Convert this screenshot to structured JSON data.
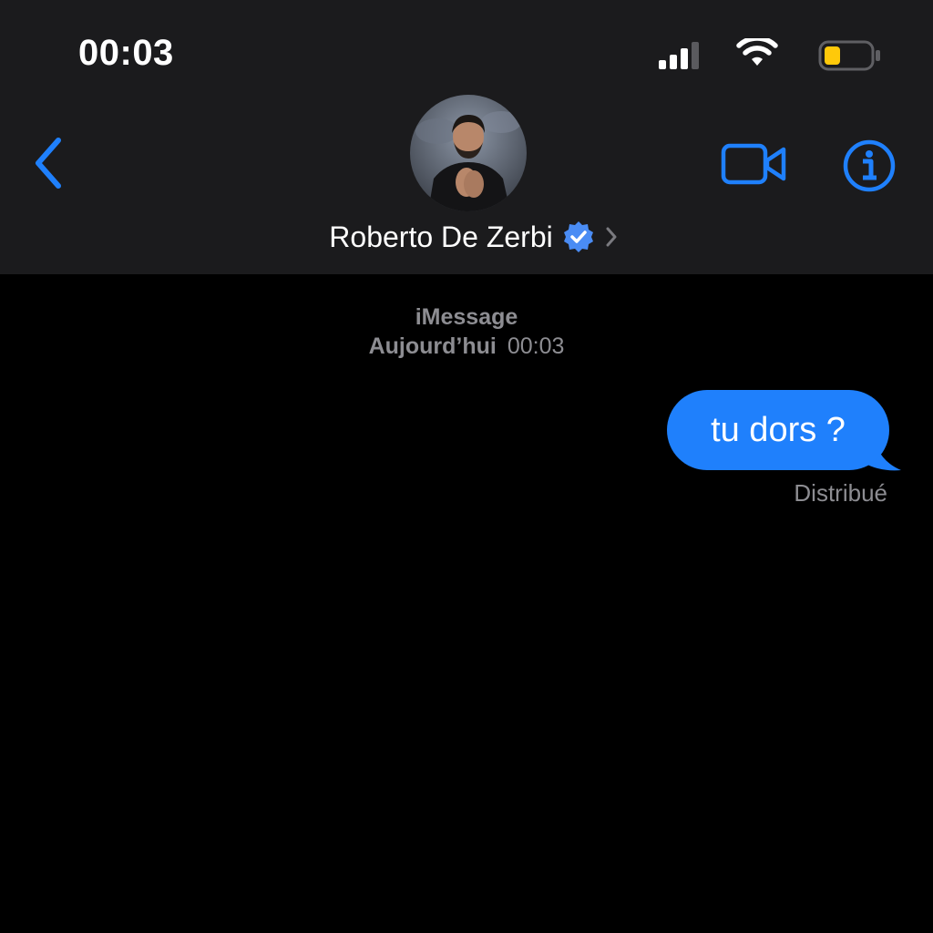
{
  "status_bar": {
    "time": "00:03",
    "icons": [
      "signal-icon",
      "wifi-icon",
      "battery-icon"
    ],
    "battery_level": 0.35,
    "battery_color": "#ffc90a"
  },
  "header": {
    "back_icon": "chevron-left-icon",
    "video_icon": "video-camera-icon",
    "info_icon": "info-icon",
    "contact_name": "Roberto De Zerbi",
    "verified_icon": "verified-badge-icon",
    "disclosure_icon": "chevron-right-icon"
  },
  "conversation": {
    "service": "iMessage",
    "timestamp_day": "Aujourd’hui",
    "timestamp_time": "00:03",
    "messages": [
      {
        "sender": "me",
        "text": "tu dors ?",
        "status": "Distribué"
      }
    ]
  },
  "colors": {
    "accent": "#1f80fc",
    "header_bg": "#1b1b1d",
    "background": "#000000",
    "secondary_text": "#8d8d92"
  }
}
